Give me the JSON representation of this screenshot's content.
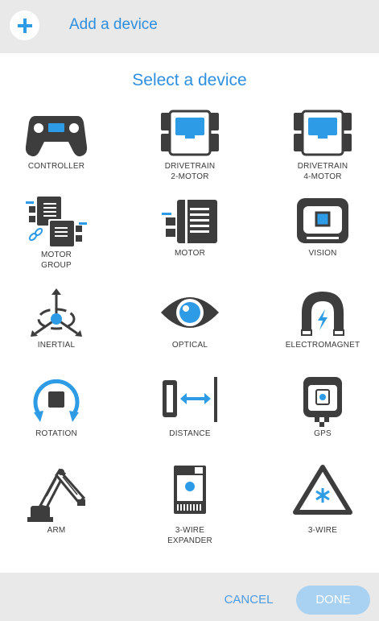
{
  "header": {
    "title": "Add a device",
    "add_icon": "plus-icon"
  },
  "section_title": "Select a device",
  "devices": [
    {
      "line1": "CONTROLLER",
      "line2": "",
      "icon": "controller-icon"
    },
    {
      "line1": "DRIVETRAIN",
      "line2": "2-MOTOR",
      "icon": "drivetrain-2-motor-icon"
    },
    {
      "line1": "DRIVETRAIN",
      "line2": "4-MOTOR",
      "icon": "drivetrain-4-motor-icon"
    },
    {
      "line1": "MOTOR",
      "line2": "GROUP",
      "icon": "motor-group-icon"
    },
    {
      "line1": "MOTOR",
      "line2": "",
      "icon": "motor-icon"
    },
    {
      "line1": "VISION",
      "line2": "",
      "icon": "vision-icon"
    },
    {
      "line1": "INERTIAL",
      "line2": "",
      "icon": "inertial-icon"
    },
    {
      "line1": "OPTICAL",
      "line2": "",
      "icon": "optical-icon"
    },
    {
      "line1": "ELECTROMAGNET",
      "line2": "",
      "icon": "electromagnet-icon"
    },
    {
      "line1": "ROTATION",
      "line2": "",
      "icon": "rotation-icon"
    },
    {
      "line1": "DISTANCE",
      "line2": "",
      "icon": "distance-icon"
    },
    {
      "line1": "GPS",
      "line2": "",
      "icon": "gps-icon"
    },
    {
      "line1": "ARM",
      "line2": "",
      "icon": "arm-icon"
    },
    {
      "line1": "3-WIRE",
      "line2": "EXPANDER",
      "icon": "3-wire-expander-icon"
    },
    {
      "line1": "3-WIRE",
      "line2": "",
      "icon": "3-wire-icon"
    }
  ],
  "footer": {
    "cancel_label": "CANCEL",
    "done_label": "DONE"
  },
  "colors": {
    "accent": "#2e8fe0",
    "icon_dark": "#3d3d3d",
    "icon_blue": "#2e9be6",
    "done_bg": "#a9d1f2"
  }
}
